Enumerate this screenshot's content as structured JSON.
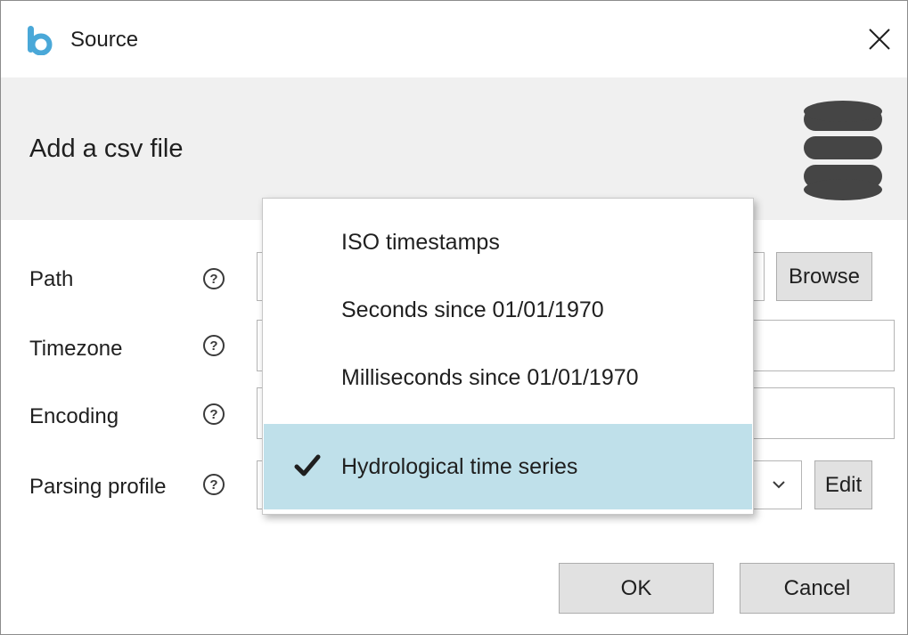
{
  "window": {
    "title": "Source",
    "close_label": "Close"
  },
  "header": {
    "title": "Add a csv file",
    "icon": "database-icon"
  },
  "form": {
    "path_label": "Path",
    "timezone_label": "Timezone",
    "encoding_label": "Encoding",
    "profile_label": "Parsing profile",
    "help_glyph": "?",
    "browse_label": "Browse",
    "edit_label": "Edit"
  },
  "dropdown": {
    "options": [
      {
        "label": "ISO timestamps",
        "selected": false
      },
      {
        "label": "Seconds since 01/01/1970",
        "selected": false
      },
      {
        "label": "Milliseconds since 01/01/1970",
        "selected": false
      },
      {
        "label": "Hydrological time series",
        "selected": true
      }
    ]
  },
  "footer": {
    "ok_label": "OK",
    "cancel_label": "Cancel"
  },
  "colors": {
    "selected_bg": "#bfe0ea",
    "app_icon": "#4aa8d8"
  }
}
